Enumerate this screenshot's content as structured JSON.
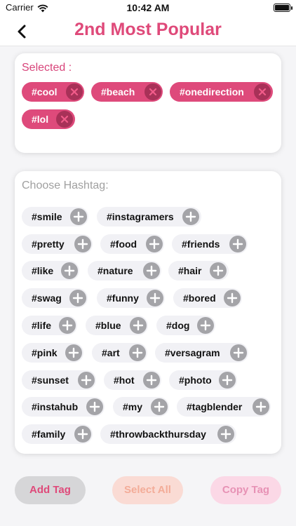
{
  "status": {
    "carrier": "Carrier",
    "time": "10:42 AM"
  },
  "nav": {
    "title": "2nd Most Popular",
    "back_icon": "chevron-left-icon"
  },
  "selected": {
    "label": "Selected :",
    "tags": [
      "#cool",
      "#beach",
      "#onedirection",
      "#lol"
    ]
  },
  "choose": {
    "label": "Choose Hashtag:",
    "tags": [
      "#smile",
      "#instagramers",
      "#pretty",
      "#food",
      "#friends",
      "#like",
      "#nature",
      "#hair",
      "#swag",
      "#funny",
      "#bored",
      "#life",
      "#blue",
      "#dog",
      "#pink",
      "#art",
      "#versagram",
      "#sunset",
      "#hot",
      "#photo",
      "#instahub",
      "#my",
      "#tagblender",
      "#family",
      "#throwbackthursday"
    ]
  },
  "buttons": {
    "add_tag": "Add Tag",
    "select_all": "Select All",
    "copy_tag": "Copy Tag"
  },
  "colors": {
    "accent": "#df4a7a",
    "chip_selected": "#de4a7b",
    "chip_remove": "#a83158",
    "chip_idle": "#f1f1f5",
    "add_icon": "#a4a4a8"
  }
}
